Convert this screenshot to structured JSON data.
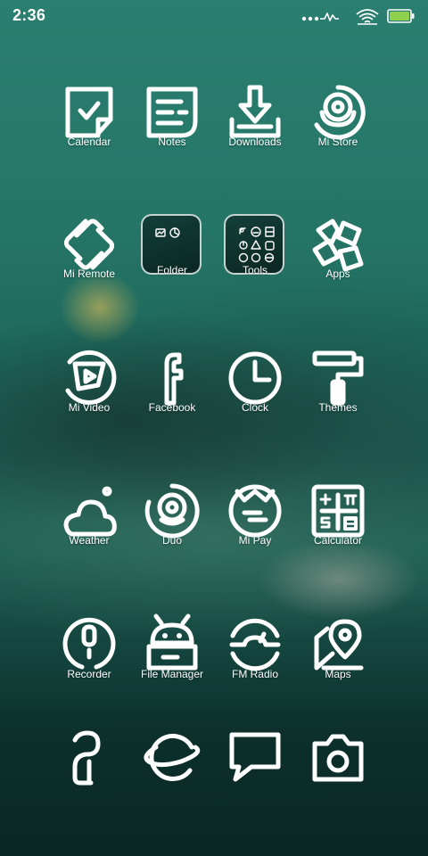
{
  "status_bar": {
    "time": "2:36",
    "battery_color": "#8fd14f"
  },
  "folder_label": "Folder",
  "tools_label": "Tools",
  "apps": {
    "calendar": "Calendar",
    "notes": "Notes",
    "downloads": "Downloads",
    "mi_store": "Mi Store",
    "mi_remote": "Mi Remote",
    "apps": "Apps",
    "mi_video": "Mi Video",
    "facebook": "Facebook",
    "clock": "Clock",
    "themes": "Themes",
    "weather": "Weather",
    "duo": "Duo",
    "mi_pay": "Mi Pay",
    "calculator": "Calculator",
    "recorder": "Recorder",
    "file_manager": "File Manager",
    "fm_radio": "FM Radio",
    "maps": "Maps"
  },
  "dock": [
    {
      "icon": "contacts-icon"
    },
    {
      "icon": "browser-icon"
    },
    {
      "icon": "messages-icon"
    },
    {
      "icon": "camera-icon"
    }
  ]
}
